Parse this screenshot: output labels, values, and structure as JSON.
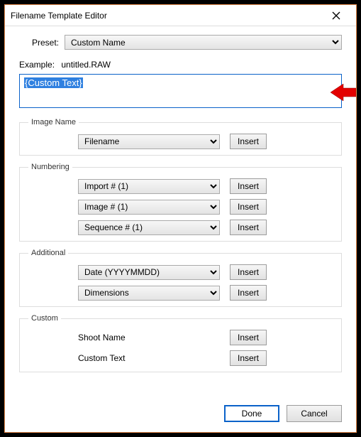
{
  "window": {
    "title": "Filename Template Editor"
  },
  "preset": {
    "label": "Preset:",
    "value": "Custom Name"
  },
  "example": {
    "label": "Example:",
    "value": "untitled.RAW"
  },
  "template": {
    "value": "{Custom Text}"
  },
  "groups": {
    "image_name": {
      "legend": "Image Name",
      "rows": [
        {
          "select": "Filename",
          "button": "Insert"
        }
      ]
    },
    "numbering": {
      "legend": "Numbering",
      "rows": [
        {
          "select": "Import # (1)",
          "button": "Insert"
        },
        {
          "select": "Image # (1)",
          "button": "Insert"
        },
        {
          "select": "Sequence # (1)",
          "button": "Insert"
        }
      ]
    },
    "additional": {
      "legend": "Additional",
      "rows": [
        {
          "select": "Date (YYYYMMDD)",
          "button": "Insert"
        },
        {
          "select": "Dimensions",
          "button": "Insert"
        }
      ]
    },
    "custom": {
      "legend": "Custom",
      "rows": [
        {
          "label": "Shoot Name",
          "button": "Insert"
        },
        {
          "label": "Custom Text",
          "button": "Insert"
        }
      ]
    }
  },
  "footer": {
    "done": "Done",
    "cancel": "Cancel"
  }
}
